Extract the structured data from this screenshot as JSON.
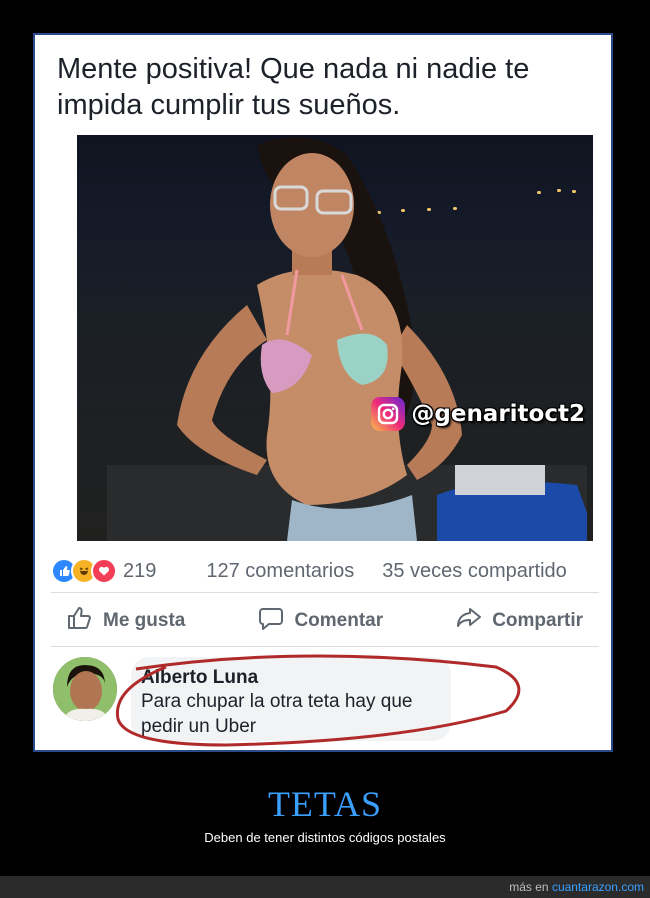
{
  "post": {
    "text": "Mente positiva! Que nada ni nadie te impida cumplir tus sueños.",
    "watermark": "@genaritoct2",
    "reaction_count": "219",
    "comments_count": "127 comentarios",
    "shares_count": "35 veces compartido"
  },
  "actions": {
    "like_label": "Me gusta",
    "comment_label": "Comentar",
    "share_label": "Compartir"
  },
  "comment": {
    "author": "Alberto Luna",
    "body": "Para chupar la otra teta hay que pedir un Uber"
  },
  "caption": {
    "title": "TETAS",
    "subtitle": "Deben de tener distintos códigos postales"
  },
  "footer": {
    "prefix": "más en",
    "link": "cuantarazon.com"
  },
  "colors": {
    "frame_border": "#2a4a8a",
    "caption_title": "#3aa0ff",
    "annotation_circle": "#b02a2a",
    "like": "#2d88ff",
    "haha": "#f7b125",
    "love": "#f33e58"
  },
  "icons": [
    "instagram-icon",
    "like-reaction-icon",
    "haha-reaction-icon",
    "love-reaction-icon",
    "thumbs-up-icon",
    "comment-icon",
    "share-arrow-icon"
  ]
}
